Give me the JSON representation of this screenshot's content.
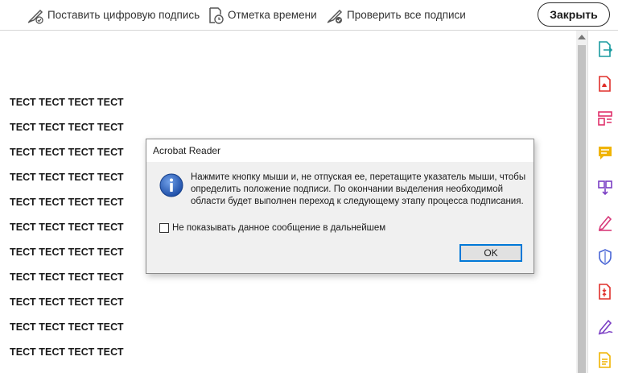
{
  "toolbar": {
    "sign_label": "Поставить цифровую подпись",
    "timestamp_label": "Отметка времени",
    "verify_label": "Проверить все подписи",
    "close_label": "Закрыть"
  },
  "document": {
    "lines": [
      "ТЕСТ ТЕСТ ТЕСТ ТЕСТ",
      "ТЕСТ ТЕСТ ТЕСТ ТЕСТ",
      "ТЕСТ ТЕСТ ТЕСТ ТЕСТ",
      "ТЕСТ ТЕСТ ТЕСТ ТЕСТ",
      "ТЕСТ ТЕСТ ТЕСТ ТЕСТ",
      "ТЕСТ ТЕСТ ТЕСТ ТЕСТ",
      "ТЕСТ ТЕСТ ТЕСТ ТЕСТ",
      "ТЕСТ ТЕСТ ТЕСТ ТЕСТ",
      "ТЕСТ ТЕСТ ТЕСТ ТЕСТ",
      "ТЕСТ ТЕСТ ТЕСТ ТЕСТ",
      "ТЕСТ ТЕСТ ТЕСТ ТЕСТ"
    ]
  },
  "dialog": {
    "title": "Acrobat Reader",
    "message": "Нажмите кнопку мыши и, не отпуская ее, перетащите указатель мыши, чтобы определить положение подписи. По окончании выделения необходимой области будет выполнен переход к следующему этапу процесса подписания.",
    "checkbox_label": "Не показывать данное сообщение в дальнейшем",
    "checkbox_checked": false,
    "ok_label": "OK"
  },
  "right_pane": {
    "tools": [
      {
        "icon": "export-pdf-icon",
        "color": "#1a9ba0"
      },
      {
        "icon": "create-pdf-icon",
        "color": "#e0302b"
      },
      {
        "icon": "edit-pdf-icon",
        "color": "#e0306a"
      },
      {
        "icon": "comment-icon",
        "color": "#f0b400"
      },
      {
        "icon": "combine-files-icon",
        "color": "#7b3fc4"
      },
      {
        "icon": "fill-sign-icon",
        "color": "#d83a7a"
      },
      {
        "icon": "protect-icon",
        "color": "#4a66d6"
      },
      {
        "icon": "compress-pdf-icon",
        "color": "#e0302b"
      },
      {
        "icon": "request-signature-icon",
        "color": "#7b3fc4"
      },
      {
        "icon": "more-tools-icon",
        "color": "#f0b400"
      }
    ]
  },
  "colors": {
    "accent": "#0078d7",
    "info_icon": "#1f4fa8"
  }
}
